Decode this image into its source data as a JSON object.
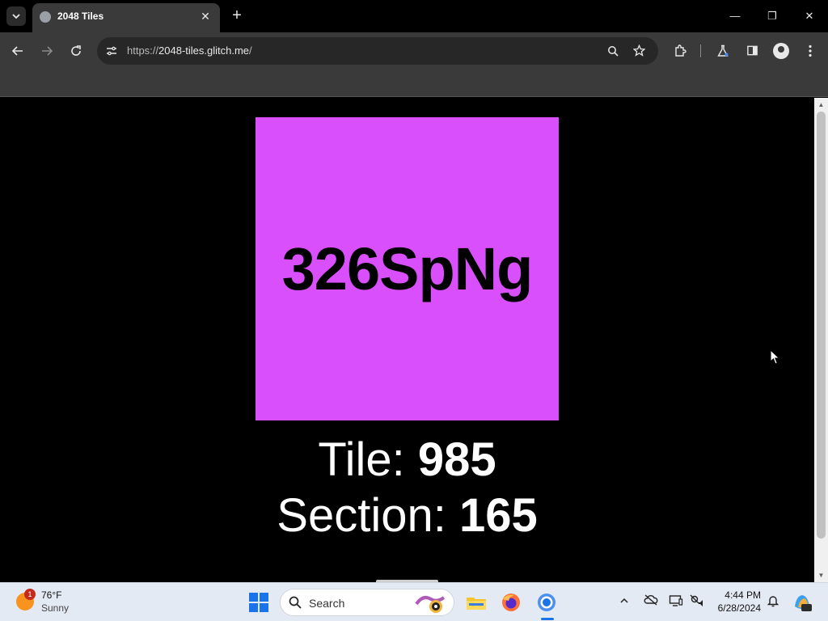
{
  "browser": {
    "tab": {
      "title": "2048 Tiles",
      "close_glyph": "✕"
    },
    "new_tab_glyph": "+",
    "window_controls": {
      "minimize": "—",
      "restore": "❐",
      "close": "✕"
    },
    "address": {
      "scheme": "https://",
      "host": "2048-tiles.glitch.me",
      "path": "/"
    }
  },
  "page": {
    "tile": {
      "text": "326SpNg",
      "color": "#d84ffb"
    },
    "tile_label": "Tile: ",
    "tile_value": "985",
    "section_label": "Section: ",
    "section_value": "165"
  },
  "taskbar": {
    "weather": {
      "badge": "1",
      "temp": "76°F",
      "condition": "Sunny"
    },
    "search": {
      "label": "Search"
    },
    "clock": {
      "time": "4:44 PM",
      "date": "6/28/2024"
    }
  }
}
